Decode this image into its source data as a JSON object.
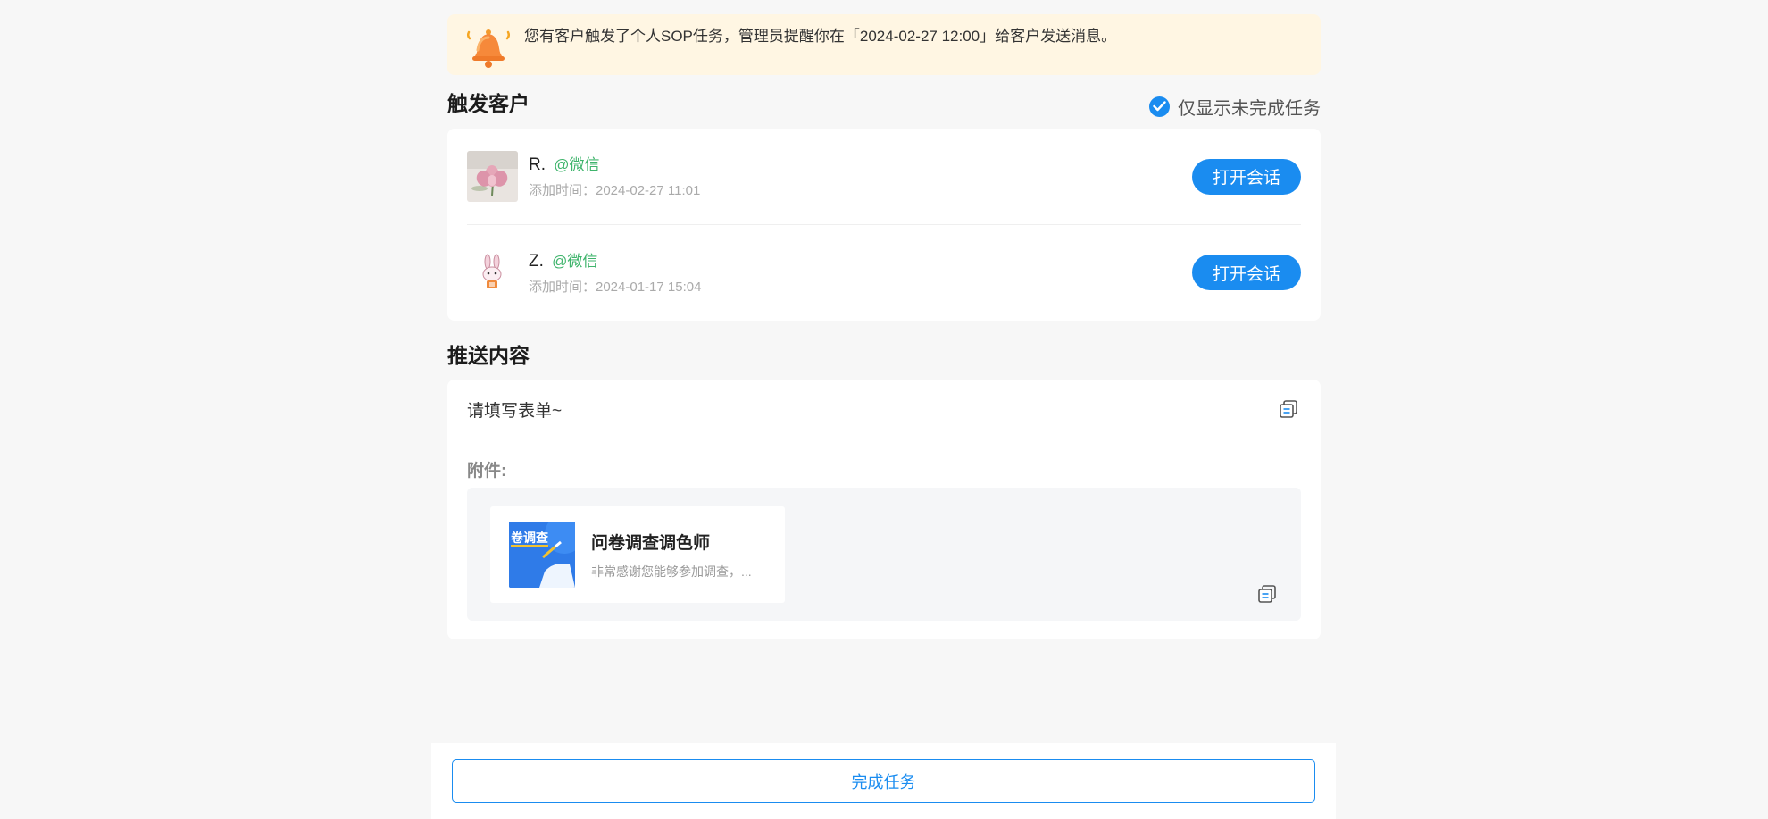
{
  "notice": {
    "text": "您有客户触发了个人SOP任务，管理员提醒你在「2024-02-27 12:00」给客户发送消息。",
    "icon": "bell-icon",
    "bg_color": "#fff6e3"
  },
  "customers_section": {
    "title": "触发客户",
    "filter_label": "仅显示未完成任务",
    "filter_checked": true
  },
  "customers": [
    {
      "name": "R.",
      "source": "@微信",
      "time": "添加时间：2024-02-27 11:01",
      "button": "打开会话"
    },
    {
      "name": "Z.",
      "source": "@微信",
      "time": "添加时间：2024-01-17 15:04",
      "button": "打开会话"
    }
  ],
  "push_section": {
    "title": "推送内容",
    "text": "请填写表单~",
    "attachment_label": "附件:",
    "attachment": {
      "thumb_text": "卷调查",
      "title": "问卷调查调色师",
      "description": "非常感谢您能够参加调查，..."
    }
  },
  "footer": {
    "finish_button": "完成任务"
  },
  "colors": {
    "accent": "#1a8cf0",
    "source_green": "#3fb46c",
    "page_bg": "#f7f7f7"
  }
}
